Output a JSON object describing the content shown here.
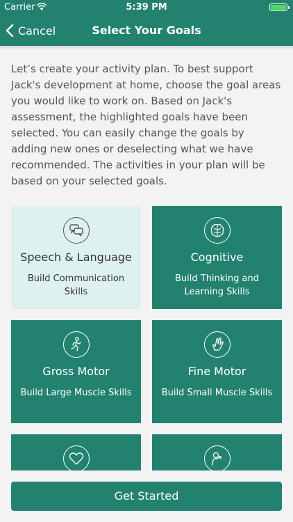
{
  "status": {
    "carrier": "Carrier",
    "time": "5:39 PM",
    "battery_color": "#4cd964"
  },
  "nav": {
    "back_label": "Cancel",
    "title": "Select Your Goals"
  },
  "intro": "Let’s create your activity plan. To best support Jack's development at home, choose the goal areas you would like to work on. Based on Jack's assessment, the highlighted goals have been selected. You can easily change the goals by adding new ones or deselecting what we have recommended. The activities in your plan will be based on your selected goals.",
  "goals": [
    {
      "title": "Speech & Language",
      "subtitle": "Build Communication Skills",
      "icon": "speech-bubbles-icon",
      "selected": false
    },
    {
      "title": "Cognitive",
      "subtitle": "Build Thinking and Learning Skills",
      "icon": "brain-icon",
      "selected": true
    },
    {
      "title": "Gross Motor",
      "subtitle": "Build Large Muscle Skills",
      "icon": "running-figure-icon",
      "selected": true
    },
    {
      "title": "Fine Motor",
      "subtitle": "Build Small Muscle Skills",
      "icon": "hand-icon",
      "selected": true
    },
    {
      "title": "",
      "subtitle": "",
      "icon": "heart-icon",
      "selected": true
    },
    {
      "title": "",
      "subtitle": "",
      "icon": "person-icon",
      "selected": true
    }
  ],
  "cta": "Get Started",
  "colors": {
    "primary": "#23826f",
    "unselected_card": "#ddf1ef",
    "background": "#f3f3f3"
  }
}
